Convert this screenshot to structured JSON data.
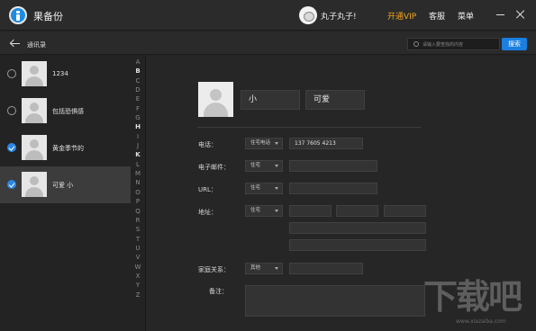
{
  "app": {
    "title": "果备份"
  },
  "header": {
    "username": "丸子丸子!",
    "vip_label": "开通VIP",
    "service_label": "客服",
    "menu_label": "菜单"
  },
  "subheader": {
    "back_label": "通讯录",
    "search_placeholder": "请输入要查找的内容",
    "search_button": "搜索"
  },
  "contacts": [
    {
      "name": "1234",
      "checked": false,
      "selected": false
    },
    {
      "name": "包括恐惧感",
      "checked": false,
      "selected": false
    },
    {
      "name": "黄金季节的",
      "checked": true,
      "selected": false
    },
    {
      "name": "可爱 小",
      "checked": true,
      "selected": true
    }
  ],
  "alphabet": [
    "A",
    "B",
    "C",
    "D",
    "E",
    "F",
    "G",
    "H",
    "I",
    "J",
    "K",
    "L",
    "M",
    "N",
    "O",
    "P",
    "Q",
    "R",
    "S",
    "T",
    "U",
    "V",
    "W",
    "X",
    "Y",
    "Z"
  ],
  "alphabet_active": [
    "B",
    "H",
    "K"
  ],
  "detail": {
    "first_name": "小",
    "last_name": "可爱",
    "phone": {
      "label": "电话：",
      "type": "住宅电话",
      "value": "137 7605 4213"
    },
    "email": {
      "label": "电子邮件：",
      "type": "住宅",
      "value": ""
    },
    "url": {
      "label": "URL：",
      "type": "住宅",
      "value": ""
    },
    "address": {
      "label": "地址：",
      "type": "住宅"
    },
    "family": {
      "label": "家庭关系：",
      "type": "其他",
      "value": ""
    },
    "note": {
      "label": "备注：",
      "value": ""
    }
  },
  "watermark": {
    "text": "下载吧",
    "url": "www.xiazaiba.com"
  },
  "colors": {
    "accent": "#1a7fe0",
    "vip": "#f5a623",
    "background": "#232323"
  }
}
